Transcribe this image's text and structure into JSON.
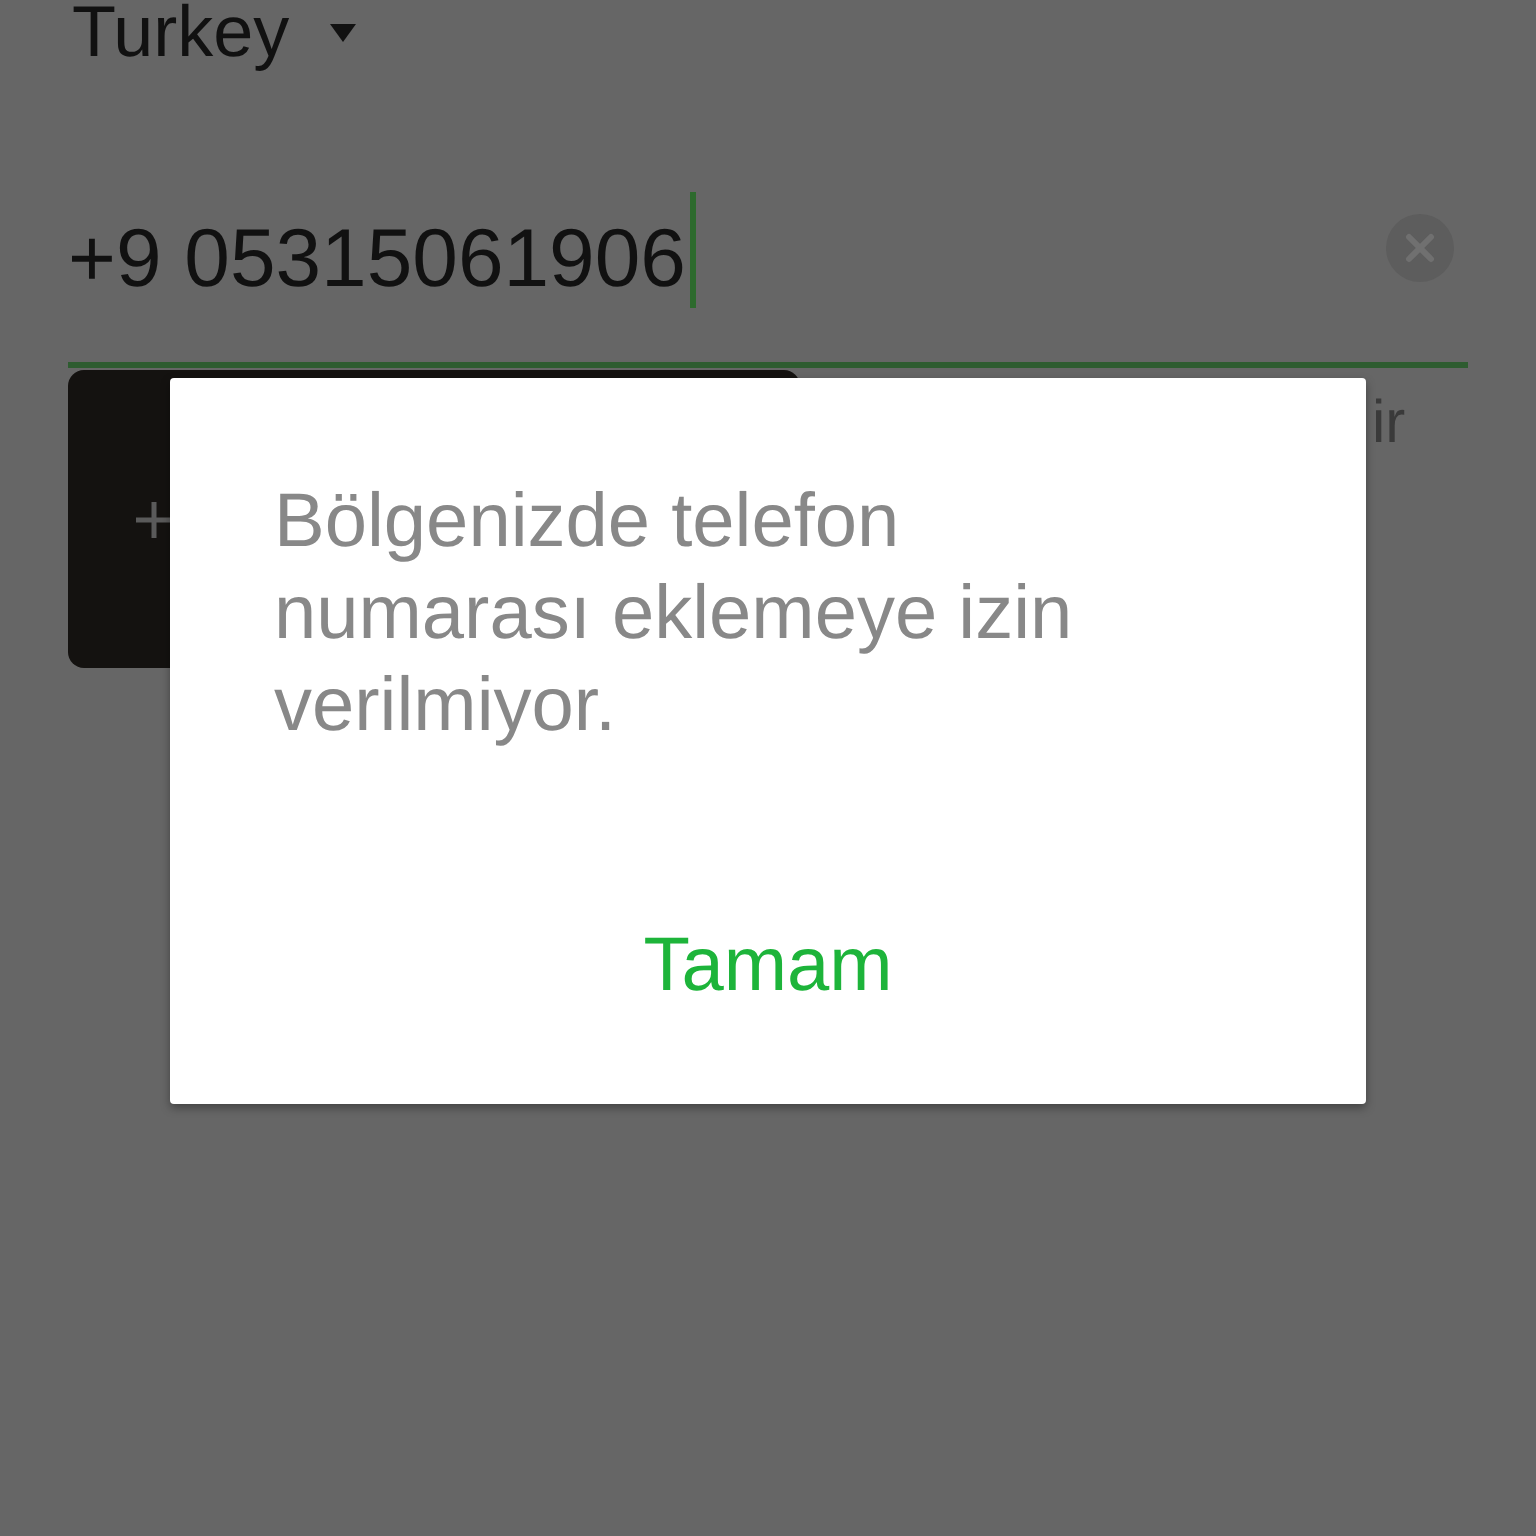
{
  "country_picker": {
    "value": "Turkey"
  },
  "phone_field": {
    "value": "+9 05315061906",
    "focused": true
  },
  "side_text": {
    "text": "ir"
  },
  "dialog": {
    "message": "Bölgenizde telefon numarası eklemeye izin verilmiyor.",
    "buttons": [
      {
        "label": "Tamam"
      }
    ]
  }
}
